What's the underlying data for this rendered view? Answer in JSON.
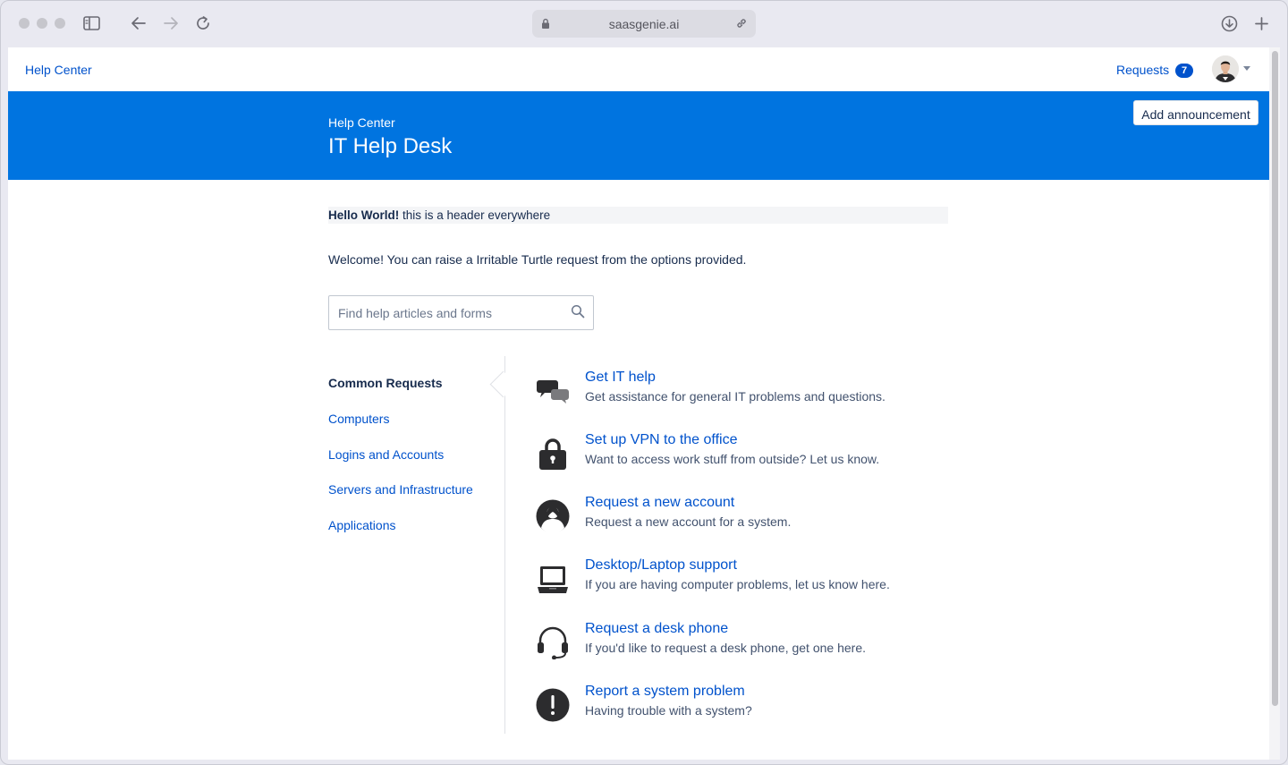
{
  "browser": {
    "url": "saasgenie.ai"
  },
  "topnav": {
    "brand": "Help Center",
    "requests_label": "Requests",
    "requests_count": "7"
  },
  "banner": {
    "subtitle": "Help Center",
    "title": "IT Help Desk",
    "add_announcement": "Add announcement"
  },
  "announcement": {
    "bold": "Hello World!",
    "text": "this is a header everywhere"
  },
  "welcome": "Welcome! You can raise a Irritable Turtle request from the options provided.",
  "search": {
    "placeholder": "Find help articles and forms"
  },
  "categories": {
    "heading": "Common Requests",
    "items": [
      "Computers",
      "Logins and Accounts",
      "Servers and Infrastructure",
      "Applications"
    ]
  },
  "requests": [
    {
      "icon": "chat-bubbles-icon",
      "title": "Get IT help",
      "desc": "Get assistance for general IT problems and questions."
    },
    {
      "icon": "padlock-icon",
      "title": "Set up VPN to the office",
      "desc": "Want to access work stuff from outside? Let us know."
    },
    {
      "icon": "person-icon",
      "title": "Request a new account",
      "desc": "Request a new account for a system."
    },
    {
      "icon": "laptop-icon",
      "title": "Desktop/Laptop support",
      "desc": "If you are having computer problems, let us know here."
    },
    {
      "icon": "headset-icon",
      "title": "Request a desk phone",
      "desc": "If you'd like to request a desk phone, get one here."
    },
    {
      "icon": "exclamation-icon",
      "title": "Report a system problem",
      "desc": "Having trouble with a system?"
    }
  ],
  "colors": {
    "banner": "#0074e0",
    "link": "#0052cc",
    "text": "#172b4d"
  }
}
